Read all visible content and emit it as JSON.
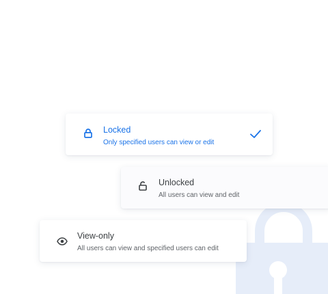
{
  "options": [
    {
      "id": "locked",
      "icon": "lock-icon",
      "title": "Locked",
      "description": "Only specified users can view or edit",
      "selected": true,
      "color": "#1a73e8"
    },
    {
      "id": "unlocked",
      "icon": "unlock-icon",
      "title": "Unlocked",
      "description": "All users can view and edit",
      "selected": false,
      "color": "#3c4043"
    },
    {
      "id": "view-only",
      "icon": "eye-icon",
      "title": "View-only",
      "description": "All users can view and  specified users can edit",
      "selected": false,
      "color": "#3c4043"
    }
  ],
  "decoration": {
    "icon": "padlock-illustration-icon",
    "color": "#e6edf9"
  }
}
